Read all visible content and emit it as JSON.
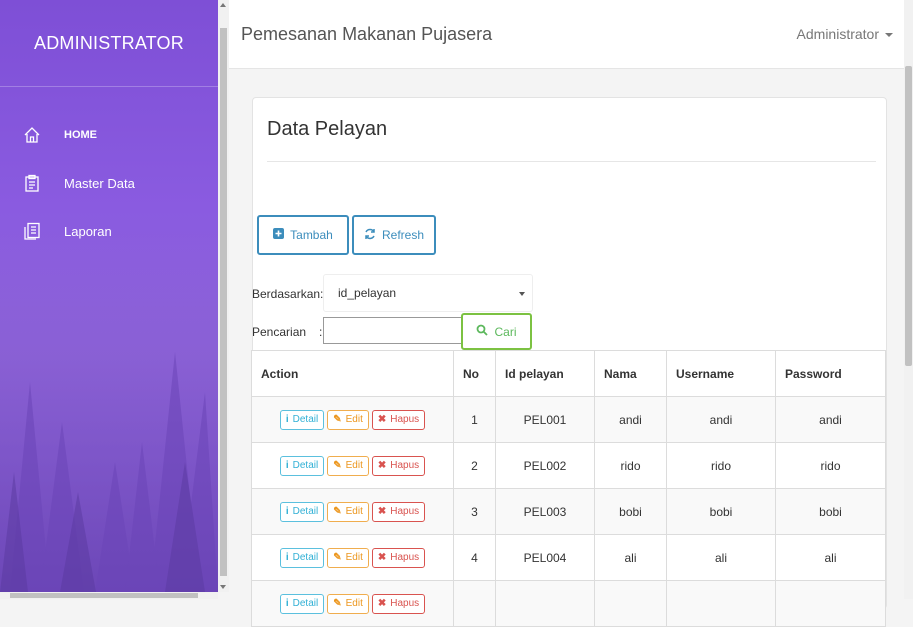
{
  "sidebar": {
    "brand": "ADMINISTRATOR",
    "items": [
      {
        "label": "HOME",
        "icon": "home-icon"
      },
      {
        "label": "Master Data",
        "icon": "clipboard-icon"
      },
      {
        "label": "Laporan",
        "icon": "report-icon"
      }
    ]
  },
  "topbar": {
    "title": "Pemesanan Makanan Pujasera",
    "user": "Administrator"
  },
  "card": {
    "title": "Data Pelayan",
    "add_label": "Tambah",
    "refresh_label": "Refresh",
    "filter_label": "Berdasarkan:",
    "filter_value": "id_pelayan",
    "search_label": "Pencarian",
    "search_colon": ":",
    "search_button": "Cari"
  },
  "table": {
    "headers": [
      "Action",
      "No",
      "Id pelayan",
      "Nama",
      "Username",
      "Password"
    ],
    "action_labels": {
      "detail": "Detail",
      "edit": "Edit",
      "hapus": "Hapus"
    },
    "rows": [
      {
        "no": "1",
        "id": "PEL001",
        "nama": "andi",
        "username": "andi",
        "password": "andi"
      },
      {
        "no": "2",
        "id": "PEL002",
        "nama": "rido",
        "username": "rido",
        "password": "rido"
      },
      {
        "no": "3",
        "id": "PEL003",
        "nama": "bobi",
        "username": "bobi",
        "password": "bobi"
      },
      {
        "no": "4",
        "id": "PEL004",
        "nama": "ali",
        "username": "ali",
        "password": "ali"
      }
    ]
  },
  "colors": {
    "sidebar": "#8a5be0",
    "primary": "#3c8dbc",
    "success": "#7cc242",
    "info": "#5bc0de",
    "warning": "#f0ad4e",
    "danger": "#d9534f"
  }
}
